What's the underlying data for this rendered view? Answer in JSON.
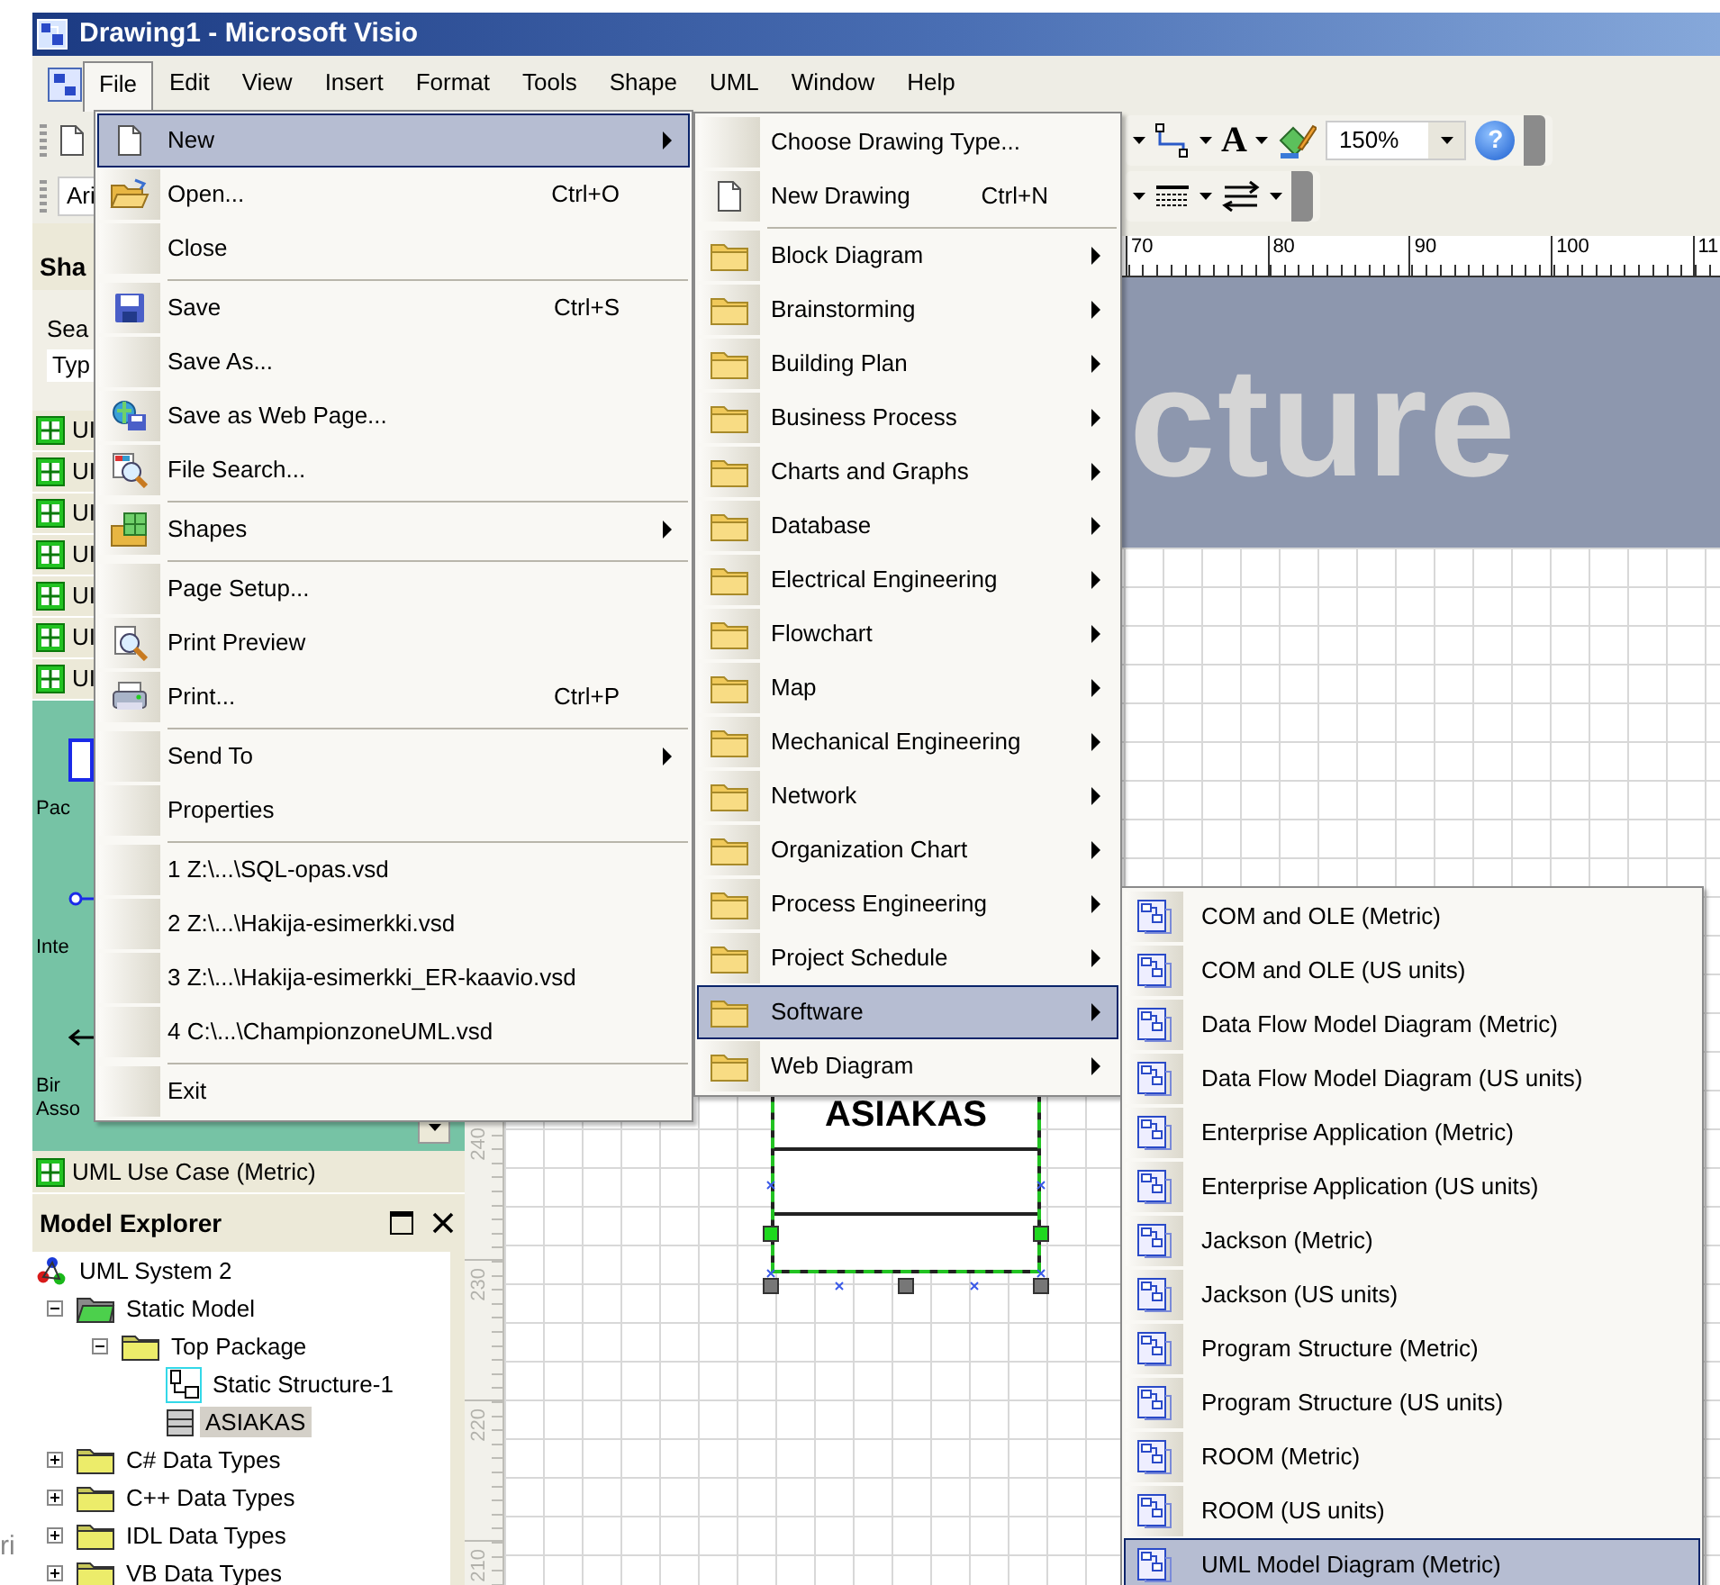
{
  "window": {
    "title": "Drawing1 - Microsoft Visio"
  },
  "menu_bar": [
    {
      "label": "File",
      "selected": true
    },
    {
      "label": "Edit",
      "selected": false
    },
    {
      "label": "View",
      "selected": false
    },
    {
      "label": "Insert",
      "selected": false
    },
    {
      "label": "Format",
      "selected": false
    },
    {
      "label": "Tools",
      "selected": false
    },
    {
      "label": "Shape",
      "selected": false
    },
    {
      "label": "UML",
      "selected": false
    },
    {
      "label": "Window",
      "selected": false
    },
    {
      "label": "Help",
      "selected": false
    }
  ],
  "standard_toolbar": {
    "text_tool": "A",
    "zoom": "150%",
    "help": "?"
  },
  "formatting_toolbar": {
    "font": "Ari"
  },
  "shapes_panel": {
    "title": "Sha",
    "search_label": "Sea",
    "search_placeholder": "Typ",
    "stencils": [
      "UI",
      "UI",
      "UI",
      "UI",
      "UI",
      "UI",
      "UI"
    ],
    "shapes": [
      {
        "label": "Pac",
        "kind": "package"
      },
      {
        "label": "Inte",
        "kind": "interface"
      },
      {
        "label": "Bir Asso",
        "kind": "association"
      }
    ],
    "current_stencil": "UML Use Case (Metric)"
  },
  "model_explorer": {
    "title": "Model Explorer",
    "tree": [
      {
        "label": "UML System 2",
        "kind": "system",
        "selected": false,
        "children": [
          {
            "label": "Static Model",
            "kind": "model",
            "expanded": true,
            "selected": false,
            "children": [
              {
                "label": "Top Package",
                "kind": "package",
                "expanded": true,
                "selected": false,
                "children": [
                  {
                    "label": "Static Structure-1",
                    "kind": "diagram",
                    "selected": false
                  },
                  {
                    "label": "ASIAKAS",
                    "kind": "class",
                    "selected": true
                  }
                ]
              }
            ]
          },
          {
            "label": "C# Data Types",
            "kind": "package",
            "expanded": false,
            "selected": false
          },
          {
            "label": "C++ Data Types",
            "kind": "package",
            "expanded": false,
            "selected": false
          },
          {
            "label": "IDL Data Types",
            "kind": "package",
            "expanded": false,
            "selected": false
          },
          {
            "label": "VB Data Types",
            "kind": "package",
            "expanded": false,
            "selected": false
          }
        ]
      }
    ]
  },
  "rulers": {
    "horizontal": [
      "70",
      "80",
      "90",
      "100",
      "11"
    ],
    "vertical": [
      "240",
      "230",
      "220",
      "210"
    ]
  },
  "canvas": {
    "banner_text": "cture",
    "class_shape": {
      "name": "ASIAKAS",
      "selected": true
    }
  },
  "file_menu": [
    {
      "label": "New",
      "kind": "page",
      "has_submenu": true,
      "selected": true
    },
    {
      "label": "Open...",
      "shortcut": "Ctrl+O",
      "kind": "folder-open",
      "has_submenu": false,
      "selected": false
    },
    {
      "label": "Close",
      "has_submenu": false,
      "selected": false
    },
    {
      "label": "Save",
      "shortcut": "Ctrl+S",
      "kind": "floppy",
      "has_submenu": false,
      "selected": false,
      "separator_before": true
    },
    {
      "label": "Save As...",
      "has_submenu": false,
      "selected": false
    },
    {
      "label": "Save as Web Page...",
      "kind": "web",
      "has_submenu": false,
      "selected": false
    },
    {
      "label": "File Search...",
      "kind": "search",
      "has_submenu": false,
      "selected": false
    },
    {
      "label": "Shapes",
      "kind": "shapes",
      "has_submenu": true,
      "selected": false,
      "separator_before": true
    },
    {
      "label": "Page Setup...",
      "has_submenu": false,
      "selected": false,
      "separator_before": true
    },
    {
      "label": "Print Preview",
      "kind": "preview",
      "has_submenu": false,
      "selected": false
    },
    {
      "label": "Print...",
      "shortcut": "Ctrl+P",
      "kind": "printer",
      "has_submenu": false,
      "selected": false
    },
    {
      "label": "Send To",
      "has_submenu": true,
      "selected": false,
      "separator_before": true
    },
    {
      "label": "Properties",
      "has_submenu": false,
      "selected": false
    },
    {
      "label": "1 Z:\\...\\SQL-opas.vsd",
      "has_submenu": false,
      "selected": false,
      "separator_before": true
    },
    {
      "label": "2 Z:\\...\\Hakija-esimerkki.vsd",
      "has_submenu": false,
      "selected": false
    },
    {
      "label": "3 Z:\\...\\Hakija-esimerkki_ER-kaavio.vsd",
      "has_submenu": false,
      "selected": false
    },
    {
      "label": "4 C:\\...\\ChampionzoneUML.vsd",
      "has_submenu": false,
      "selected": false
    },
    {
      "label": "Exit",
      "has_submenu": false,
      "selected": false,
      "separator_before": true
    }
  ],
  "new_menu": [
    {
      "label": "Choose Drawing Type...",
      "has_submenu": false,
      "selected": false
    },
    {
      "label": "New Drawing",
      "shortcut": "Ctrl+N",
      "kind": "page",
      "has_submenu": false,
      "selected": false
    },
    {
      "label": "Block Diagram",
      "kind": "folder",
      "has_submenu": true,
      "selected": false,
      "separator_before": true
    },
    {
      "label": "Brainstorming",
      "kind": "folder",
      "has_submenu": true,
      "selected": false
    },
    {
      "label": "Building Plan",
      "kind": "folder",
      "has_submenu": true,
      "selected": false
    },
    {
      "label": "Business Process",
      "kind": "folder",
      "has_submenu": true,
      "selected": false
    },
    {
      "label": "Charts and Graphs",
      "kind": "folder",
      "has_submenu": true,
      "selected": false
    },
    {
      "label": "Database",
      "kind": "folder",
      "has_submenu": true,
      "selected": false
    },
    {
      "label": "Electrical Engineering",
      "kind": "folder",
      "has_submenu": true,
      "selected": false
    },
    {
      "label": "Flowchart",
      "kind": "folder",
      "has_submenu": true,
      "selected": false
    },
    {
      "label": "Map",
      "kind": "folder",
      "has_submenu": true,
      "selected": false
    },
    {
      "label": "Mechanical Engineering",
      "kind": "folder",
      "has_submenu": true,
      "selected": false
    },
    {
      "label": "Network",
      "kind": "folder",
      "has_submenu": true,
      "selected": false
    },
    {
      "label": "Organization Chart",
      "kind": "folder",
      "has_submenu": true,
      "selected": false
    },
    {
      "label": "Process Engineering",
      "kind": "folder",
      "has_submenu": true,
      "selected": false
    },
    {
      "label": "Project Schedule",
      "kind": "folder",
      "has_submenu": true,
      "selected": false
    },
    {
      "label": "Software",
      "kind": "folder",
      "has_submenu": true,
      "selected": true
    },
    {
      "label": "Web Diagram",
      "kind": "folder",
      "has_submenu": true,
      "selected": false
    }
  ],
  "software_menu": [
    {
      "label": "COM and OLE (Metric)",
      "kind": "template",
      "selected": false
    },
    {
      "label": "COM and OLE (US units)",
      "kind": "template",
      "selected": false
    },
    {
      "label": "Data Flow Model Diagram (Metric)",
      "kind": "template",
      "selected": false
    },
    {
      "label": "Data Flow Model Diagram (US units)",
      "kind": "template",
      "selected": false
    },
    {
      "label": "Enterprise Application (Metric)",
      "kind": "template",
      "selected": false
    },
    {
      "label": "Enterprise Application (US units)",
      "kind": "template",
      "selected": false
    },
    {
      "label": "Jackson (Metric)",
      "kind": "template",
      "selected": false
    },
    {
      "label": "Jackson (US units)",
      "kind": "template",
      "selected": false
    },
    {
      "label": "Program Structure (Metric)",
      "kind": "template",
      "selected": false
    },
    {
      "label": "Program Structure (US units)",
      "kind": "template",
      "selected": false
    },
    {
      "label": "ROOM (Metric)",
      "kind": "template",
      "selected": false
    },
    {
      "label": "ROOM (US units)",
      "kind": "template",
      "selected": false
    },
    {
      "label": "UML Model Diagram (Metric)",
      "kind": "template",
      "selected": true
    }
  ],
  "outside_text": "ri"
}
